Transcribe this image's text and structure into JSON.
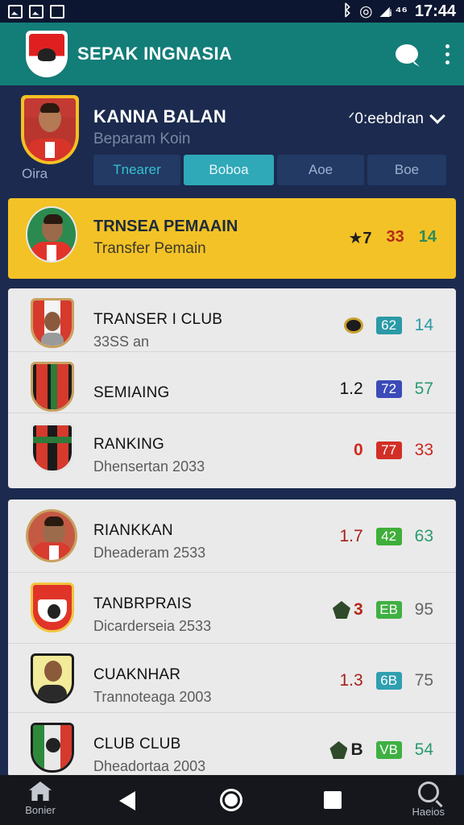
{
  "status_bar": {
    "time": "17:44",
    "icons": [
      "image-icon",
      "image-icon",
      "flag-icon",
      "bluetooth-icon",
      "alarm-icon",
      "signal-icon",
      "wifi-icon"
    ],
    "signal_text": "◢ᵢ ⁴⁶"
  },
  "app_bar": {
    "title": "SEPAK INGNASIA",
    "icons": [
      "chat-icon",
      "more-vert-icon"
    ],
    "color": "#137d78"
  },
  "profile": {
    "name": "KANNA BALAN",
    "caption": "Beparam Koin",
    "sub": "Oira",
    "season_label": "ᐟ0:eebdran"
  },
  "tabs": [
    {
      "label": "Tnearer"
    },
    {
      "label": "Boboa"
    },
    {
      "label": "Aoe"
    },
    {
      "label": "Boe"
    }
  ],
  "featured": {
    "title": "TRNSEA PEMAAIN",
    "subtitle": "Transfer Pemain",
    "stats": [
      "★7",
      "33",
      "14"
    ],
    "color": "#f3c226"
  },
  "list1": [
    {
      "title": "TRANSER I CLUB",
      "subtitle": "33SS an",
      "stat1": "",
      "pill": "62",
      "stat2": "14"
    },
    {
      "title": "SEMIAING",
      "subtitle": "",
      "stat1": "1.2",
      "pill": "72",
      "stat2": "57"
    },
    {
      "title": "RANKING",
      "subtitle": "Dhensertan 2033",
      "stat1": "0",
      "pill": "77",
      "stat2": "33"
    }
  ],
  "list2": [
    {
      "title": "RIANKKAN",
      "subtitle": "Dheaderam 2533",
      "stat1": "1.7",
      "pill": "42",
      "stat2": "63"
    },
    {
      "title": "TANBRPRAIS",
      "subtitle": "Dicarderseia 2533",
      "stat1": "3",
      "pill": "EB",
      "stat2": "95"
    },
    {
      "title": "CUAKNHAR",
      "subtitle": "Trannoteaga 2003",
      "stat1": "1.3",
      "pill": "6B",
      "stat2": "75"
    },
    {
      "title": "CLUB CLUB",
      "subtitle": "Dheadortaa 2003",
      "stat1": "B",
      "pill": "VB",
      "stat2": "54"
    }
  ],
  "nav": {
    "home_label": "Bonier",
    "search_label": "Haeios"
  }
}
